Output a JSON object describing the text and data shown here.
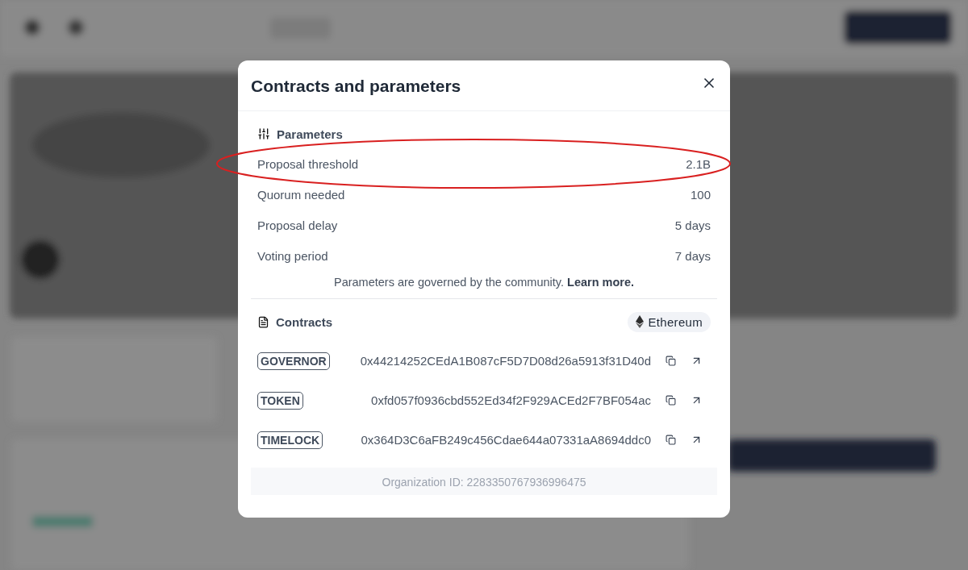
{
  "dialog": {
    "title": "Contracts and parameters",
    "parameters": {
      "heading": "Parameters",
      "rows": [
        {
          "label": "Proposal threshold",
          "value": "2.1B",
          "highlighted": true
        },
        {
          "label": "Quorum needed",
          "value": "100",
          "highlighted": false
        },
        {
          "label": "Proposal delay",
          "value": "5 days",
          "highlighted": false
        },
        {
          "label": "Voting period",
          "value": "7 days",
          "highlighted": false
        }
      ],
      "note": "Parameters are governed by the community.",
      "note_link": "Learn more."
    },
    "contracts": {
      "heading": "Contracts",
      "network": "Ethereum",
      "rows": [
        {
          "tag": "GOVERNOR",
          "address": "0x44214252CEdA1B087cF5D7D08d26a5913f31D40d"
        },
        {
          "tag": "TOKEN",
          "address": "0xfd057f0936cbd552Ed34f2F929ACEd2F7BF054ac"
        },
        {
          "tag": "TIMELOCK",
          "address": "0x364D3C6aFB249c456Cdae644a07331aA8694ddc0"
        }
      ],
      "org_id": "Organization ID: 2283350767936996475"
    }
  }
}
